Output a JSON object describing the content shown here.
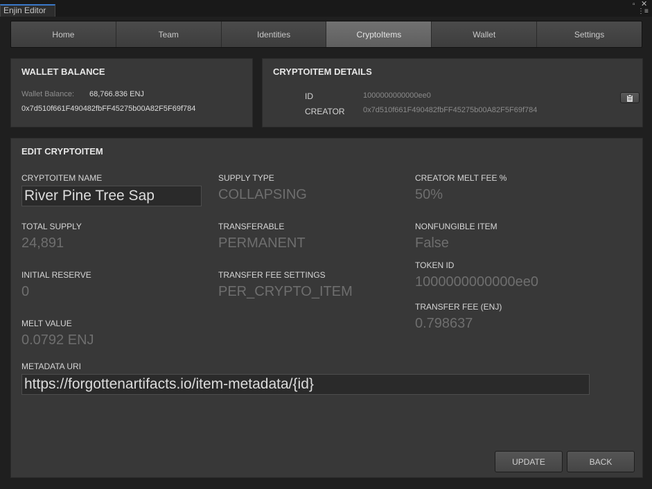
{
  "window": {
    "tab_title": "Enjin Editor",
    "close_glyph": "✕",
    "maximize_glyph": "▫",
    "menu_glyph": "⋮≡"
  },
  "nav": {
    "tabs": [
      {
        "label": "Home",
        "active": false
      },
      {
        "label": "Team",
        "active": false
      },
      {
        "label": "Identities",
        "active": false
      },
      {
        "label": "CryptoItems",
        "active": true
      },
      {
        "label": "Wallet",
        "active": false
      },
      {
        "label": "Settings",
        "active": false
      }
    ]
  },
  "wallet": {
    "title": "WALLET BALANCE",
    "balance_label": "Wallet Balance:",
    "balance_value": "68,766.836 ENJ",
    "address": "0x7d510f661F490482fbFF45275b00A82F5F69f784"
  },
  "details": {
    "title": "CRYPTOITEM DETAILS",
    "id_label": "ID",
    "id_value": "1000000000000ee0",
    "creator_label": "CREATOR",
    "creator_value": "0x7d510f661F490482fbFF45275b00A82F5F69f784",
    "copy_icon": "clipboard-icon"
  },
  "edit": {
    "title": "EDIT CRYPTOITEM",
    "name_label": "CRYPTOITEM NAME",
    "name_value": "River Pine Tree Sap",
    "supply_type_label": "SUPPLY TYPE",
    "supply_type_value": "COLLAPSING",
    "melt_fee_label": "CREATOR MELT FEE %",
    "melt_fee_value": "50%",
    "total_supply_label": "TOTAL SUPPLY",
    "total_supply_value": "24,891",
    "transferable_label": "TRANSFERABLE",
    "transferable_value": "PERMANENT",
    "nonfungible_label": "NONFUNGIBLE ITEM",
    "nonfungible_value": "False",
    "initial_reserve_label": "INITIAL RESERVE",
    "initial_reserve_value": "0",
    "transfer_fee_settings_label": "TRANSFER FEE SETTINGS",
    "transfer_fee_settings_value": "PER_CRYPTO_ITEM",
    "token_id_label": "TOKEN ID",
    "token_id_value": "1000000000000ee0",
    "transfer_fee_label": "TRANSFER FEE (ENJ)",
    "transfer_fee_value": "0.798637",
    "melt_value_label": "MELT VALUE",
    "melt_value_value": "0.0792 ENJ",
    "metadata_label": "METADATA URI",
    "metadata_value": "https://forgottenartifacts.io/item-metadata/{id}",
    "update_button": "UPDATE",
    "back_button": "BACK"
  }
}
